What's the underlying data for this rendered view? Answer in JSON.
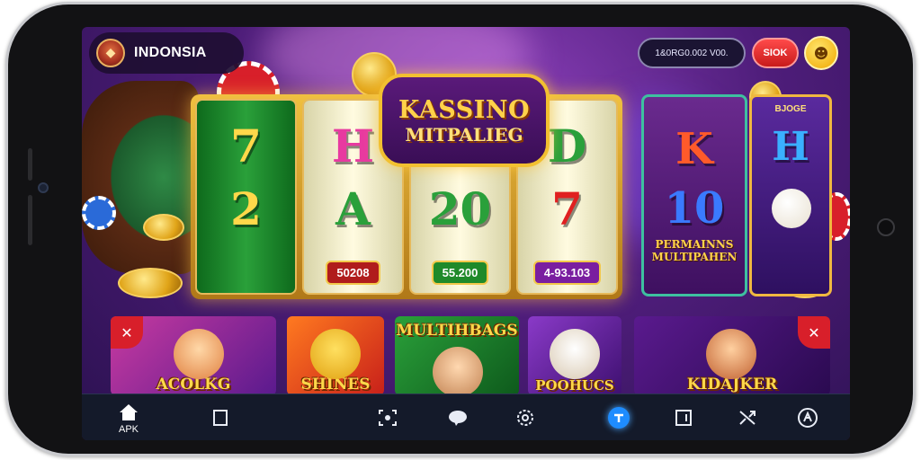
{
  "header": {
    "region": "INDONSIA",
    "balance": "1&0RG0.002 V00.",
    "signin_label": "SIOK"
  },
  "logo": {
    "line1": "KASSINO",
    "line2": "MITPALIEG"
  },
  "slot": {
    "reels": [
      {
        "top": "7",
        "middle": "2",
        "label": ""
      },
      {
        "top": "H",
        "middle": "A",
        "label": "50208"
      },
      {
        "top": "",
        "middle": "20",
        "label": "55.200"
      },
      {
        "top": "D",
        "middle": "7",
        "label": "4-93.103"
      }
    ]
  },
  "side_card": {
    "top": "K",
    "middle": "10",
    "label": "PERMAINNS MULTIPAHEN"
  },
  "side_card_2": {
    "badge": "BJOGE",
    "symbol": "H"
  },
  "games": [
    {
      "title": "ACOLKG"
    },
    {
      "title": "SHINES"
    },
    {
      "title": "MULTIHBAGS"
    },
    {
      "title": "POOHUCS"
    },
    {
      "title": "KIDAJKER"
    }
  ],
  "bottom_nav": {
    "home_label": "APK"
  },
  "colors": {
    "background": "#4e1d7a",
    "accent_gold": "#f2c030",
    "danger_red": "#d81f2a",
    "nav_active": "#1e8cff"
  },
  "icons": {
    "home": "home-icon",
    "bookmark": "bookmark-icon",
    "scan": "scan-icon",
    "chat": "chat-icon",
    "settings": "settings-icon",
    "upload": "upload-icon",
    "wallet": "wallet-icon",
    "swap": "swap-icon",
    "profile": "profile-icon"
  }
}
